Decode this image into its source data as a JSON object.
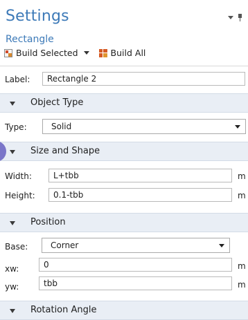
{
  "header": {
    "title": "Settings",
    "subtitle": "Rectangle"
  },
  "toolbar": {
    "build_selected": "Build Selected",
    "build_all": "Build All"
  },
  "label_field": {
    "label": "Label:",
    "value": "Rectangle 2"
  },
  "sections": {
    "object_type": "Object Type",
    "size_shape": "Size and Shape",
    "position": "Position",
    "rotation": "Rotation Angle"
  },
  "object_type": {
    "label": "Type:",
    "value": "Solid"
  },
  "size": {
    "width_label": "Width:",
    "width_value": "L+tbb",
    "width_unit": "m",
    "height_label": "Height:",
    "height_value": "0.1-tbb",
    "height_unit": "m"
  },
  "position": {
    "base_label": "Base:",
    "base_value": "Corner",
    "xw_label": "xw:",
    "xw_value": "0",
    "xw_unit": "m",
    "yw_label": "yw:",
    "yw_value": "tbb",
    "yw_unit": "m"
  },
  "colors": {
    "title_blue": "#3d7ab8",
    "section_bg": "#e9eef5"
  }
}
